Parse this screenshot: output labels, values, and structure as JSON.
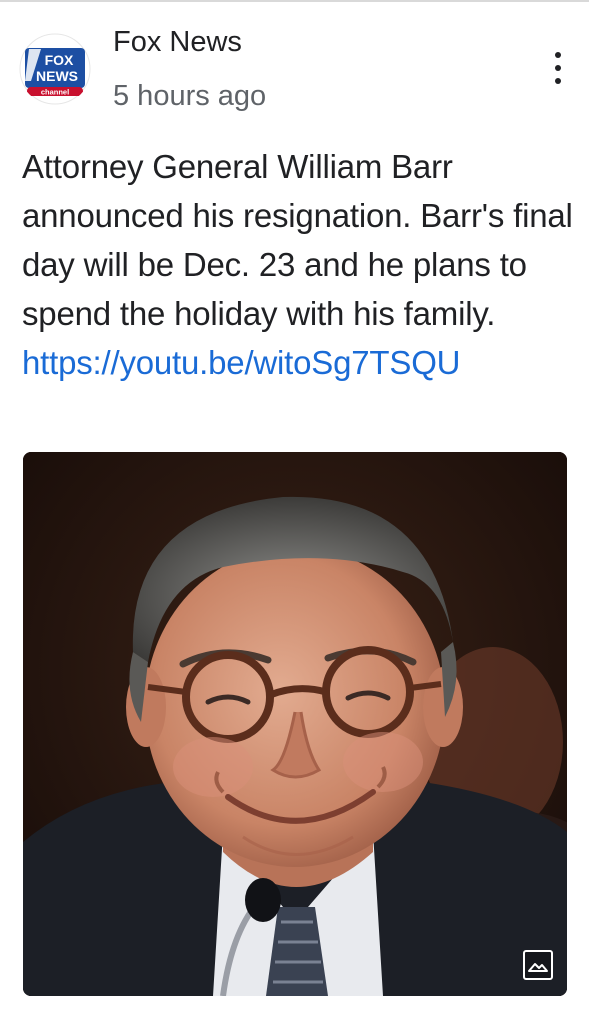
{
  "post": {
    "author": {
      "name": "Fox News",
      "avatar_logo": {
        "line1": "FOX",
        "line2": "NEWS",
        "line3": "channel"
      }
    },
    "timestamp": "5 hours ago",
    "text": "Attorney General William Barr announced his resignation. Barr's final day will be Dec. 23 and he plans to spend the holiday with his family.",
    "link": "https://youtu.be/witoSg7TSQU",
    "image": {
      "icon": "image-icon"
    },
    "menu_icon": "more-vert-icon"
  },
  "colors": {
    "link": "#1a6bd6",
    "text": "#202124",
    "secondary_text": "#5f6368",
    "fox_blue": "#1d4fa3",
    "fox_red": "#c8102e"
  }
}
